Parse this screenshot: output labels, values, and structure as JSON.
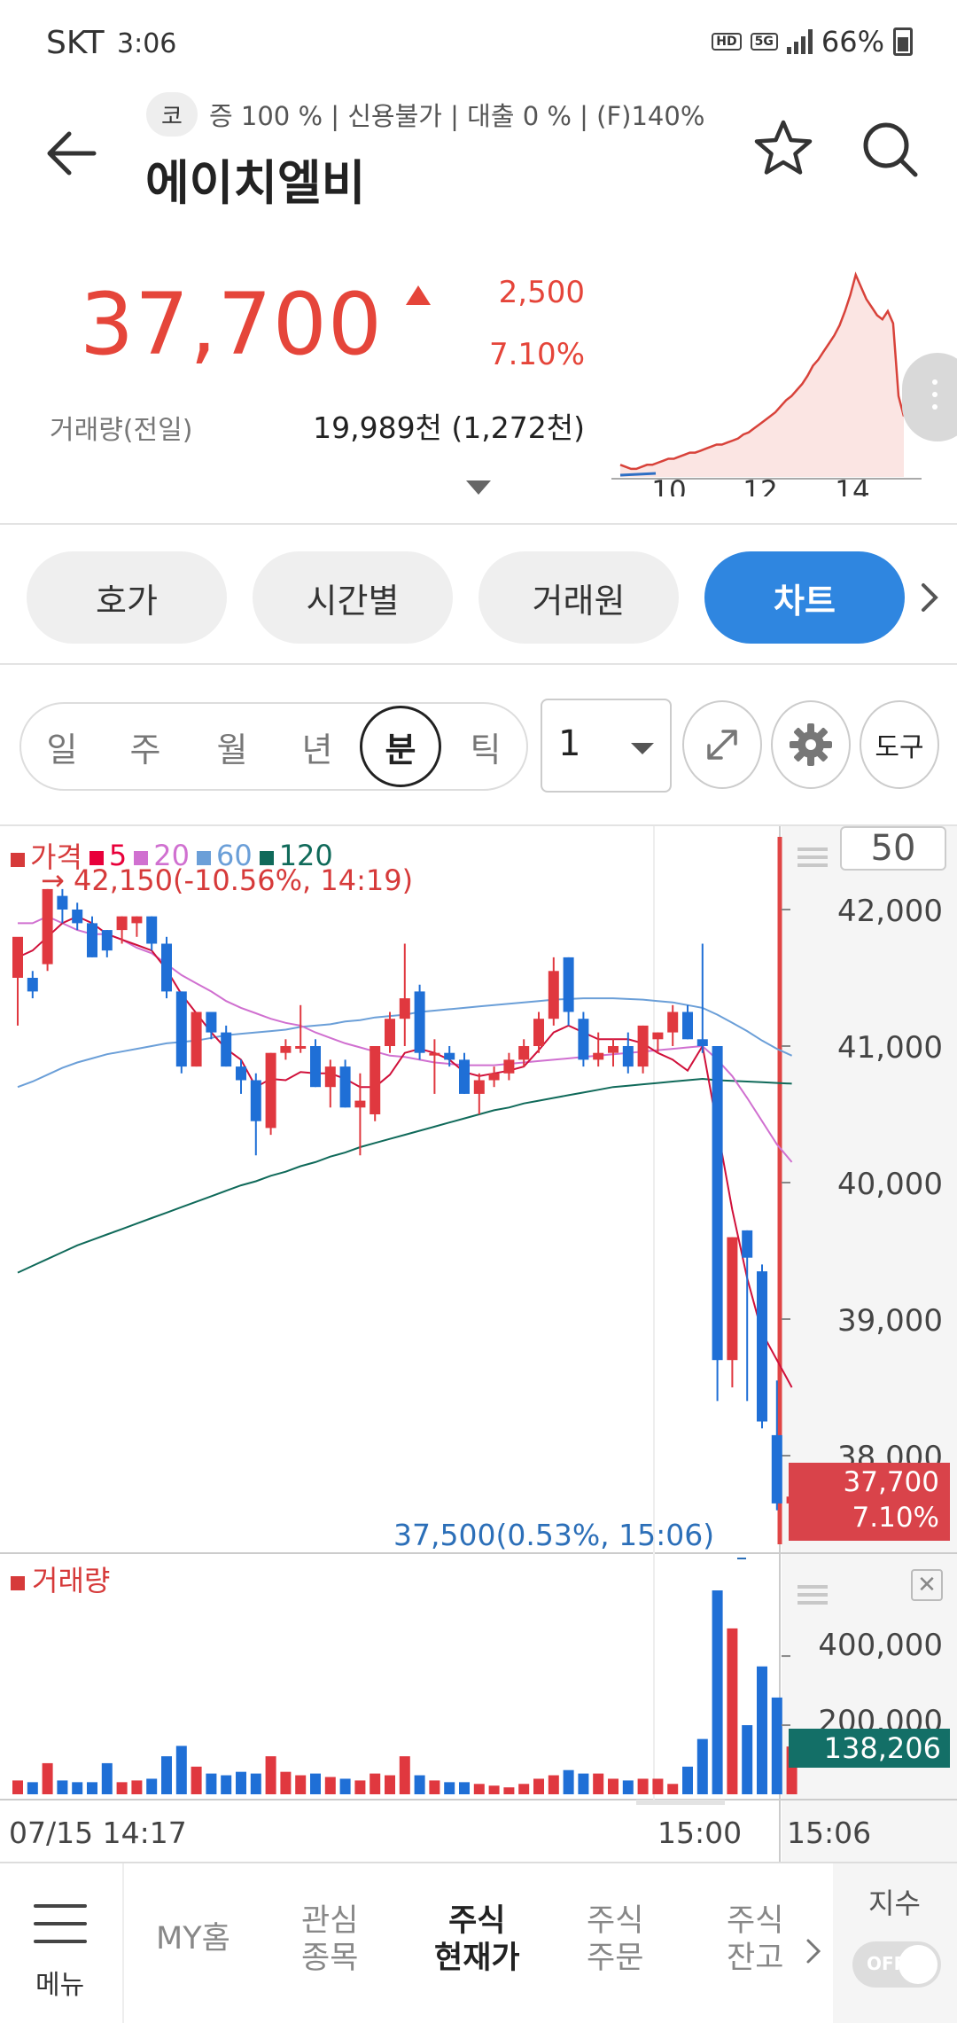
{
  "status_bar": {
    "carrier": "SKT",
    "time": "3:06",
    "hd_label": "HD",
    "net_label": "5G",
    "battery": "66%"
  },
  "header": {
    "market_badge": "코",
    "stock_info": "증 100 % | 신용불가 | 대출 0 % | (F)140%",
    "stock_name": "에이치엘비"
  },
  "quote": {
    "price": "37,700",
    "change_amount": "2,500",
    "change_percent": "7.10%",
    "volume_label": "거래량(전일)",
    "volume_value": "19,989천 (1,272천)",
    "sparkline_labels": [
      "10",
      "12",
      "14"
    ],
    "sparkline_values": [
      6,
      5,
      4,
      4,
      5,
      6,
      6,
      7,
      8,
      9,
      9,
      10,
      11,
      12,
      12,
      13,
      14,
      15,
      16,
      16,
      17,
      18,
      19,
      21,
      22,
      24,
      26,
      28,
      30,
      32,
      35,
      38,
      40,
      43,
      46,
      50,
      55,
      58,
      62,
      66,
      70,
      75,
      82,
      90,
      100,
      94,
      88,
      84,
      80,
      78,
      82,
      76,
      40,
      30
    ],
    "colors": {
      "up": "#e5453a",
      "sparkline": "#d8423a"
    }
  },
  "tabs": [
    {
      "label": "호가",
      "active": false
    },
    {
      "label": "시간별",
      "active": false
    },
    {
      "label": "거래원",
      "active": false
    },
    {
      "label": "차트",
      "active": true
    }
  ],
  "period": {
    "items": [
      "일",
      "주",
      "월",
      "년",
      "분",
      "틱"
    ],
    "active": "분",
    "interval_value": "1",
    "tool_label": "도구"
  },
  "chart": {
    "zoom_value": "50",
    "legend": [
      {
        "label": "가격",
        "color": "#d63a3a"
      },
      {
        "label": "5",
        "color": "#e8003a"
      },
      {
        "label": "20",
        "color": "#d070d0"
      },
      {
        "label": "60",
        "color": "#6b9fd8"
      },
      {
        "label": "120",
        "color": "#106a5a"
      }
    ],
    "high_note": "→ 42,150(-10.56%, 14:19)",
    "low_note": "37,500(0.53%, 15:06)",
    "current_tag_price": "37,700",
    "current_tag_pct": "7.10%",
    "volume_legend": "거래량",
    "volume_tag": "138,206",
    "close_symbol": "✕",
    "x_labels": [
      "07/15 14:17",
      "15:00",
      "15:06"
    ]
  },
  "chart_data": {
    "type": "candlestick",
    "y_price_ticks": [
      "42,000",
      "41,000",
      "40,000",
      "39,000",
      "38,000"
    ],
    "ylim_price": [
      37400,
      42500
    ],
    "y_volume_ticks": [
      "400,000",
      "200,000"
    ],
    "ylim_volume": [
      0,
      600000
    ],
    "candles": [
      {
        "o": 41500,
        "h": 41700,
        "l": 41150,
        "c": 41800
      },
      {
        "o": 41500,
        "h": 41550,
        "l": 41350,
        "c": 41400
      },
      {
        "o": 41600,
        "h": 42150,
        "l": 41550,
        "c": 42150
      },
      {
        "o": 42100,
        "h": 42150,
        "l": 41900,
        "c": 42000
      },
      {
        "o": 42000,
        "h": 42050,
        "l": 41850,
        "c": 41900
      },
      {
        "o": 41900,
        "h": 41950,
        "l": 41650,
        "c": 41650
      },
      {
        "o": 41850,
        "h": 41850,
        "l": 41650,
        "c": 41700
      },
      {
        "o": 41850,
        "h": 41950,
        "l": 41750,
        "c": 41950
      },
      {
        "o": 41900,
        "h": 41950,
        "l": 41800,
        "c": 41950
      },
      {
        "o": 41950,
        "h": 41950,
        "l": 41700,
        "c": 41750
      },
      {
        "o": 41750,
        "h": 41800,
        "l": 41350,
        "c": 41400
      },
      {
        "o": 41400,
        "h": 41400,
        "l": 40800,
        "c": 40850
      },
      {
        "o": 40850,
        "h": 41250,
        "l": 40850,
        "c": 41250
      },
      {
        "o": 41250,
        "h": 41250,
        "l": 41050,
        "c": 41100
      },
      {
        "o": 41100,
        "h": 41150,
        "l": 40850,
        "c": 40850
      },
      {
        "o": 40850,
        "h": 40900,
        "l": 40650,
        "c": 40750
      },
      {
        "o": 40750,
        "h": 40800,
        "l": 40200,
        "c": 40450
      },
      {
        "o": 40400,
        "h": 40950,
        "l": 40350,
        "c": 40950
      },
      {
        "o": 40950,
        "h": 41050,
        "l": 40900,
        "c": 41000
      },
      {
        "o": 41000,
        "h": 41300,
        "l": 40950,
        "c": 41000
      },
      {
        "o": 41000,
        "h": 41050,
        "l": 40700,
        "c": 40700
      },
      {
        "o": 40700,
        "h": 40900,
        "l": 40550,
        "c": 40850
      },
      {
        "o": 40850,
        "h": 40900,
        "l": 40550,
        "c": 40550
      },
      {
        "o": 40550,
        "h": 40800,
        "l": 40200,
        "c": 40600
      },
      {
        "o": 40500,
        "h": 41000,
        "l": 40450,
        "c": 41000
      },
      {
        "o": 41000,
        "h": 41250,
        "l": 40950,
        "c": 41200
      },
      {
        "o": 41200,
        "h": 41750,
        "l": 41000,
        "c": 41350
      },
      {
        "o": 41400,
        "h": 41450,
        "l": 40900,
        "c": 40950
      },
      {
        "o": 40950,
        "h": 41050,
        "l": 40650,
        "c": 40950
      },
      {
        "o": 40950,
        "h": 41000,
        "l": 40850,
        "c": 40900
      },
      {
        "o": 40900,
        "h": 40950,
        "l": 40650,
        "c": 40650
      },
      {
        "o": 40650,
        "h": 40800,
        "l": 40500,
        "c": 40750
      },
      {
        "o": 40750,
        "h": 40850,
        "l": 40700,
        "c": 40800
      },
      {
        "o": 40800,
        "h": 40950,
        "l": 40750,
        "c": 40900
      },
      {
        "o": 40900,
        "h": 41050,
        "l": 40850,
        "c": 41000
      },
      {
        "o": 41000,
        "h": 41250,
        "l": 40950,
        "c": 41200
      },
      {
        "o": 41200,
        "h": 41650,
        "l": 41150,
        "c": 41550
      },
      {
        "o": 41650,
        "h": 41650,
        "l": 41150,
        "c": 41250
      },
      {
        "o": 41200,
        "h": 41250,
        "l": 40850,
        "c": 40900
      },
      {
        "o": 40900,
        "h": 41100,
        "l": 40850,
        "c": 40950
      },
      {
        "o": 40950,
        "h": 41050,
        "l": 40850,
        "c": 41000
      },
      {
        "o": 41000,
        "h": 41100,
        "l": 40800,
        "c": 40850
      },
      {
        "o": 40850,
        "h": 41150,
        "l": 40800,
        "c": 41150
      },
      {
        "o": 41050,
        "h": 41100,
        "l": 40950,
        "c": 41100
      },
      {
        "o": 41100,
        "h": 41300,
        "l": 41000,
        "c": 41250
      },
      {
        "o": 41250,
        "h": 41300,
        "l": 41050,
        "c": 41050
      },
      {
        "o": 41050,
        "h": 41750,
        "l": 40950,
        "c": 41000
      },
      {
        "o": 41000,
        "h": 41000,
        "l": 38400,
        "c": 38700
      },
      {
        "o": 38700,
        "h": 39600,
        "l": 38500,
        "c": 39600
      },
      {
        "o": 39650,
        "h": 39650,
        "l": 38400,
        "c": 39450
      },
      {
        "o": 39350,
        "h": 39400,
        "l": 38200,
        "c": 38250
      },
      {
        "o": 38150,
        "h": 38550,
        "l": 37600,
        "c": 37650
      },
      {
        "o": 37650,
        "h": 37900,
        "l": 37500,
        "c": 37700
      }
    ],
    "ma5": [
      41650,
      41700,
      41800,
      41900,
      41950,
      41900,
      41820,
      41780,
      41740,
      41700,
      41560,
      41380,
      41240,
      41100,
      40980,
      40900,
      40700,
      40760,
      40750,
      40810,
      40800,
      40800,
      40760,
      40700,
      40700,
      40790,
      40950,
      40980,
      40950,
      40900,
      40810,
      40780,
      40800,
      40820,
      40850,
      40970,
      41100,
      41150,
      41100,
      41050,
      41050,
      41050,
      41020,
      40950,
      40900,
      40820,
      41000,
      40400,
      39800,
      39300,
      38900,
      38700,
      38500
    ],
    "ma20": [
      41900,
      41900,
      41950,
      41900,
      41850,
      41820,
      41820,
      41780,
      41720,
      41680,
      41600,
      41520,
      41460,
      41400,
      41330,
      41280,
      41240,
      41200,
      41170,
      41150,
      41100,
      41060,
      41020,
      40990,
      40960,
      40930,
      40920,
      40900,
      40880,
      40870,
      40860,
      40860,
      40860,
      40870,
      40880,
      40890,
      40900,
      40910,
      40920,
      40930,
      40940,
      40950,
      40960,
      40970,
      40980,
      40990,
      41000,
      40900,
      40780,
      40620,
      40450,
      40280,
      40150
    ],
    "ma60": [
      40700,
      40740,
      40790,
      40840,
      40880,
      40910,
      40940,
      40960,
      40980,
      41000,
      41020,
      41030,
      41040,
      41060,
      41080,
      41090,
      41100,
      41110,
      41120,
      41140,
      41150,
      41160,
      41180,
      41190,
      41210,
      41220,
      41230,
      41250,
      41260,
      41270,
      41280,
      41290,
      41300,
      41310,
      41320,
      41330,
      41340,
      41345,
      41350,
      41350,
      41350,
      41345,
      41340,
      41330,
      41320,
      41300,
      41280,
      41230,
      41170,
      41110,
      41040,
      40980,
      40930
    ],
    "ma120": [
      39340,
      39390,
      39440,
      39490,
      39540,
      39580,
      39620,
      39660,
      39700,
      39740,
      39780,
      39820,
      39860,
      39900,
      39940,
      39980,
      40010,
      40050,
      40080,
      40120,
      40150,
      40190,
      40220,
      40260,
      40290,
      40320,
      40350,
      40380,
      40410,
      40440,
      40470,
      40500,
      40530,
      40550,
      40580,
      40600,
      40620,
      40640,
      40660,
      40680,
      40700,
      40710,
      40720,
      40730,
      40740,
      40750,
      40760,
      40750,
      40745,
      40740,
      40735,
      40730,
      40725
    ],
    "volumes": [
      40000,
      35000,
      90000,
      40000,
      35000,
      35000,
      90000,
      35000,
      40000,
      45000,
      110000,
      140000,
      80000,
      60000,
      55000,
      65000,
      60000,
      110000,
      65000,
      55000,
      60000,
      50000,
      45000,
      40000,
      60000,
      55000,
      110000,
      55000,
      40000,
      35000,
      35000,
      30000,
      25000,
      20000,
      30000,
      45000,
      55000,
      70000,
      60000,
      60000,
      45000,
      40000,
      45000,
      45000,
      30000,
      80000,
      160000,
      590000,
      480000,
      200000,
      370000,
      280000,
      138206
    ]
  }
}
